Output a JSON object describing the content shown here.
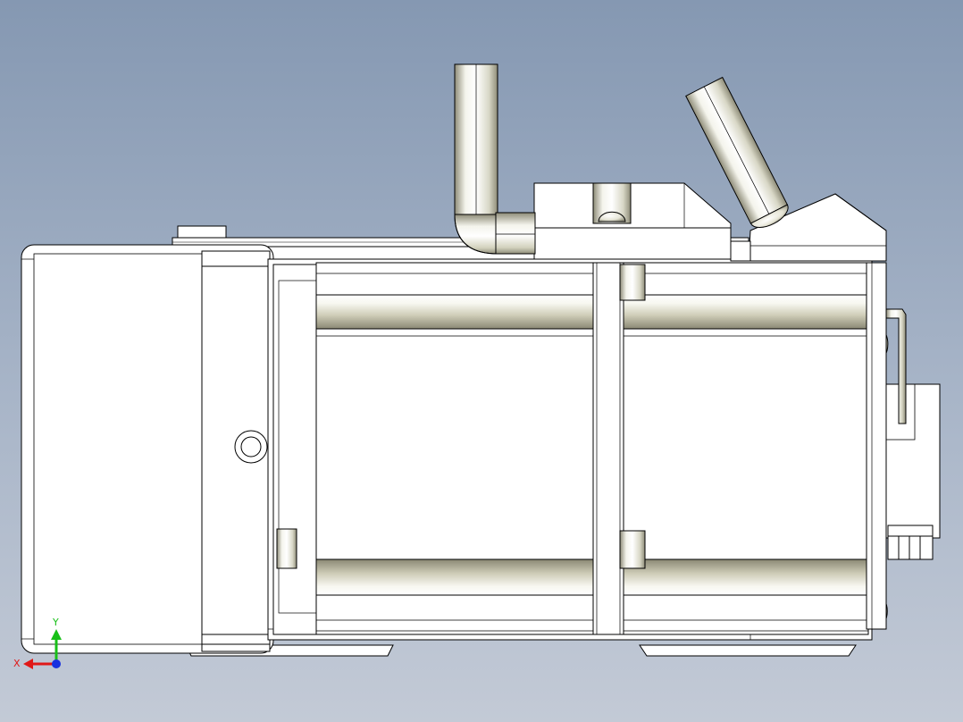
{
  "triad": {
    "x_label": "X",
    "y_label": "Y",
    "x_color": "#e01818",
    "y_color": "#18c018",
    "z_color": "#1830e0"
  },
  "colors": {
    "background_top": "#8598b2",
    "background_bottom": "#c3cad6",
    "edge": "#000000",
    "face": "#ffffff",
    "shade": "#b8b7a3"
  },
  "icons": {
    "triad": "coordinate-triad-icon"
  }
}
